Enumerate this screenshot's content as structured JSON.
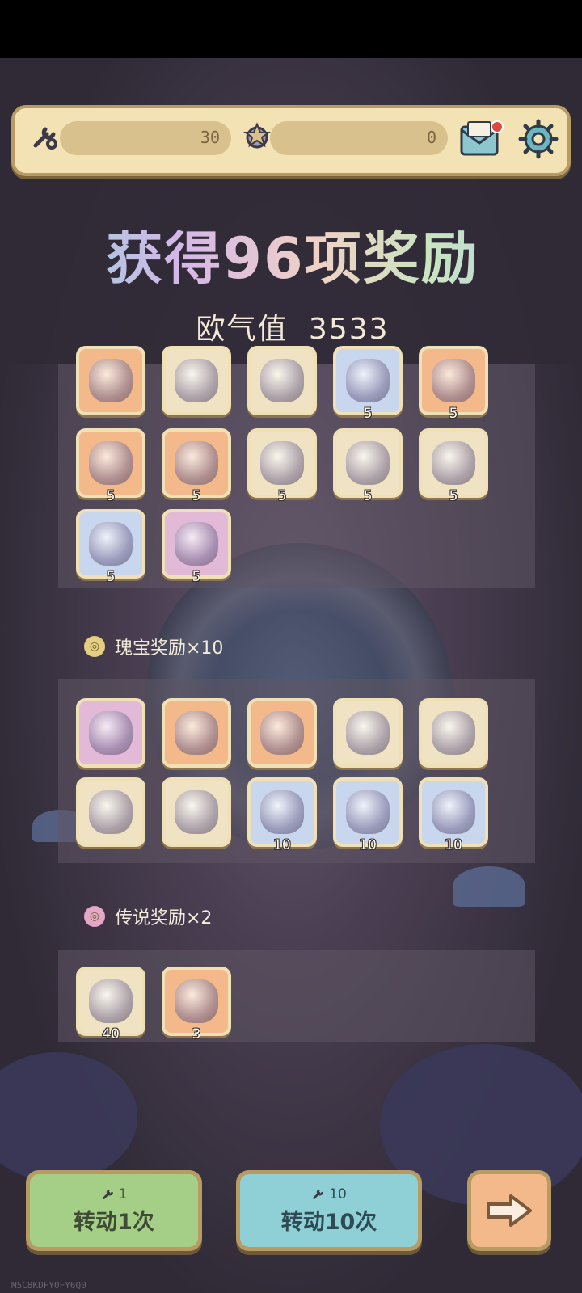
{
  "topbar": {
    "spin_tickets": "30",
    "spin_tickets_icon": "wrench-ticket-icon",
    "medals": "0",
    "medals_icon": "medal-icon",
    "mail_icon": "mail-icon",
    "settings_icon": "gear-icon"
  },
  "popup": {
    "title": "获得96项奖励",
    "luck_label": "欧气值",
    "luck_value": "3533"
  },
  "rewards_common": {
    "rows": [
      [
        {
          "icon": "crystal-crown-icon",
          "color": "orange",
          "count": ""
        },
        {
          "icon": "scroll-potion-icon",
          "color": "cream",
          "count": ""
        },
        {
          "icon": "spellbook-icon",
          "color": "cream",
          "count": ""
        },
        {
          "icon": "water-orb-icon",
          "color": "blue",
          "count": "5"
        },
        {
          "icon": "fire-crest-icon",
          "color": "orange",
          "count": "5"
        }
      ],
      [
        {
          "icon": "fire-crest-icon",
          "color": "orange",
          "count": "5"
        },
        {
          "icon": "fire-crest-icon",
          "color": "orange",
          "count": "5"
        },
        {
          "icon": "golden-gauntlet-icon",
          "color": "cream",
          "count": "5"
        },
        {
          "icon": "golden-gauntlet-icon",
          "color": "cream",
          "count": "5"
        },
        {
          "icon": "golden-gauntlet-icon",
          "color": "cream",
          "count": "5"
        }
      ],
      [
        {
          "icon": "ice-crystal-icon",
          "color": "blue",
          "count": "5"
        },
        {
          "icon": "pink-rune-cube-icon",
          "color": "pink",
          "count": "5"
        }
      ]
    ]
  },
  "rewards_treasure": {
    "label": "瑰宝奖励×10",
    "badge_icon": "gold-coin-icon",
    "rows": [
      [
        {
          "icon": "stone-totem-icon",
          "color": "pink",
          "count": ""
        },
        {
          "icon": "blue-gem-egg-icon",
          "color": "orange",
          "count": ""
        },
        {
          "icon": "blue-gem-egg-icon",
          "color": "orange",
          "count": ""
        },
        {
          "icon": "treasure-chest-icon",
          "color": "cream",
          "count": ""
        },
        {
          "icon": "ancient-tablet-icon",
          "color": "cream",
          "count": ""
        }
      ],
      [
        {
          "icon": "open-map-book-icon",
          "color": "cream",
          "count": ""
        },
        {
          "icon": "golden-globe-icon",
          "color": "cream",
          "count": ""
        },
        {
          "icon": "water-orb-icon",
          "color": "blue",
          "count": "10"
        },
        {
          "icon": "water-drop-orb-icon",
          "color": "blue",
          "count": "10"
        },
        {
          "icon": "ice-crystal-icon",
          "color": "blue",
          "count": "10"
        }
      ]
    ]
  },
  "rewards_legendary": {
    "label": "传说奖励×2",
    "badge_icon": "pink-coin-icon",
    "rows": [
      [
        {
          "icon": "ancient-map-icon",
          "color": "cream",
          "count": "40"
        },
        {
          "icon": "spirit-orb-icon",
          "color": "orange",
          "count": "3"
        }
      ]
    ]
  },
  "buttons": {
    "spin1_cost": "1",
    "spin1_label": "转动1次",
    "spin10_cost": "10",
    "spin10_label": "转动10次",
    "next_icon": "arrow-right-icon"
  },
  "watermark": "M5C8KDFY0FY6Q0",
  "colors": {
    "tile_orange": "#f4b98a",
    "tile_blue": "#c8d6ee",
    "tile_cream": "#efe3c3",
    "tile_pink": "#e3b9d8",
    "btn_green": "#a5cf86",
    "btn_teal": "#8fd0d6"
  }
}
